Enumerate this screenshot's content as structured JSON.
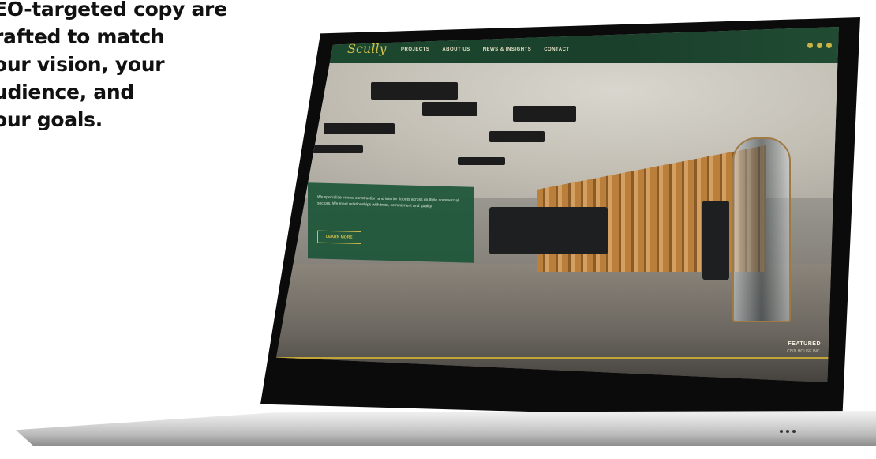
{
  "marketing_copy": {
    "lines": [
      "EO-targeted copy are",
      "rafted to match",
      "our vision, your",
      "udience, and",
      "our goals."
    ]
  },
  "website": {
    "logo": "Scully",
    "nav": [
      "PROJECTS",
      "ABOUT US",
      "NEWS & INSIGHTS",
      "CONTACT"
    ],
    "hero": {
      "text": "We specialize in new construction and interior fit outs across multiple commercial sectors. We meet relationships with trust, commitment and quality.",
      "button": "LEARN MORE"
    },
    "featured": {
      "label": "FEATURED",
      "subtitle": "CIVIL HOUSE INC."
    }
  },
  "colors": {
    "brand_green": "#1d4a30",
    "accent_gold": "#c2a536"
  }
}
